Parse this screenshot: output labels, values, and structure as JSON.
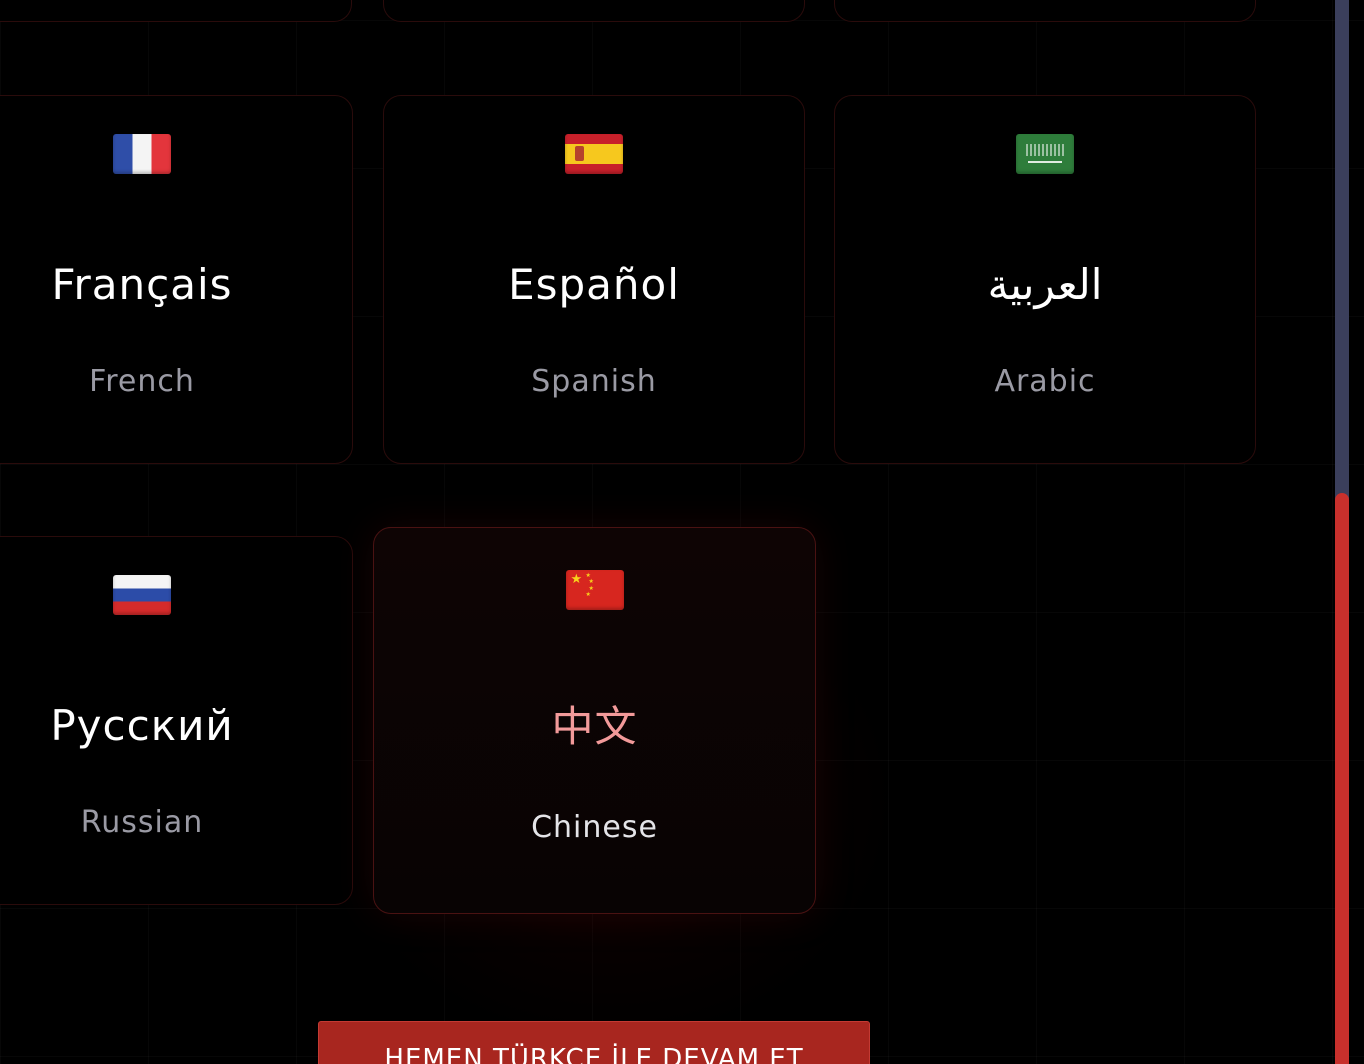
{
  "languages": [
    {
      "native": "Français",
      "english": "French",
      "flag": "flag-france-icon",
      "selected": false
    },
    {
      "native": "Español",
      "english": "Spanish",
      "flag": "flag-spain-icon",
      "selected": false
    },
    {
      "native": "العربية",
      "english": "Arabic",
      "flag": "flag-saudi-arabia-icon",
      "selected": false
    },
    {
      "native": "Русский",
      "english": "Russian",
      "flag": "flag-russia-icon",
      "selected": false
    },
    {
      "native": "中文",
      "english": "Chinese",
      "flag": "flag-china-icon",
      "selected": true
    }
  ],
  "continue_button": {
    "label": "HEMEN TÜRKÇE İLE DEVAM ET"
  },
  "colors": {
    "accent": "#a8261f",
    "selected_native_text": "#f29a9a",
    "scroll_thumb": "#c8302c",
    "scroll_track": "#3b3f5c"
  }
}
